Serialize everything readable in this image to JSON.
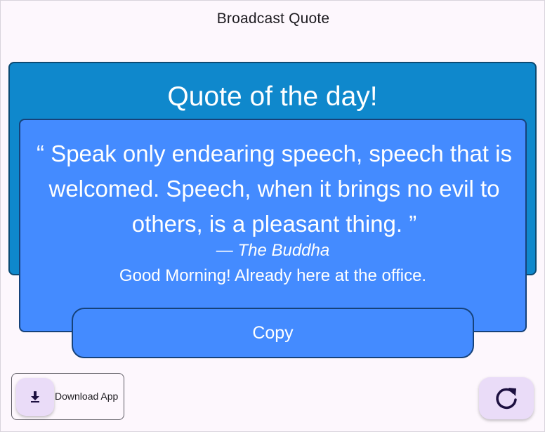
{
  "app": {
    "title": "Broadcast Quote"
  },
  "quote_card": {
    "heading": "Quote of the day!",
    "quote_text": "“ Speak only endearing speech, speech that is welcomed. Speech, when it brings no evil to others, is a pleasant thing. ”",
    "author": "— The Buddha",
    "greeting": "Good Morning! Already here at the office.",
    "copy_label": "Copy"
  },
  "actions": {
    "download_label": "Download App",
    "download_icon": "download-icon",
    "refresh_icon": "refresh-icon"
  },
  "colors": {
    "background": "#fdf7fd",
    "outer_card": "#0f88cc",
    "inner_card": "#448bff",
    "fab": "#eadcf8",
    "icon": "#1d1040"
  }
}
